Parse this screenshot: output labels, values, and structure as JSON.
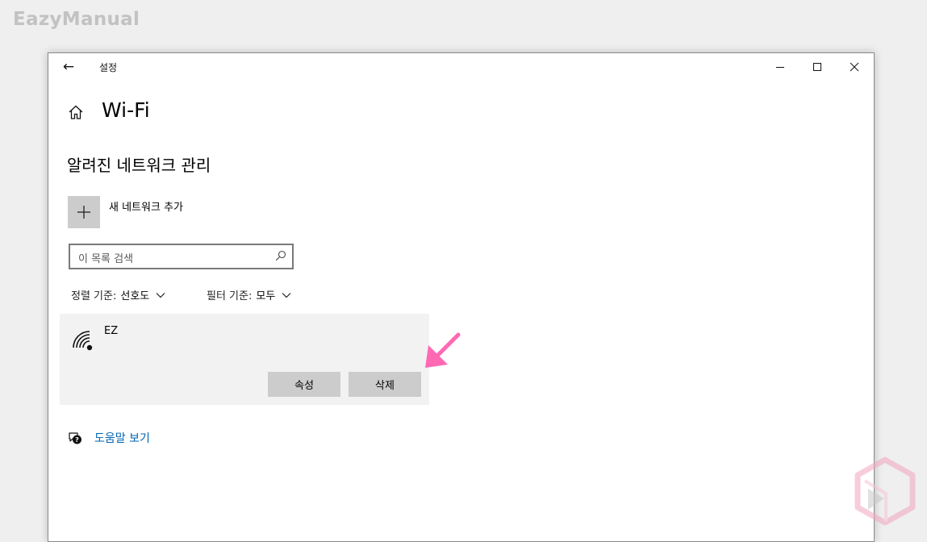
{
  "watermark": {
    "text": "EazyManual"
  },
  "window": {
    "title": "설정",
    "back_icon": "back-arrow-icon",
    "controls": [
      "minimize-icon",
      "maximize-icon",
      "close-icon"
    ]
  },
  "page": {
    "home_icon": "home-icon",
    "title": "Wi-Fi",
    "section_title": "알려진 네트워크 관리"
  },
  "add_network": {
    "icon": "plus-icon",
    "label": "새 네트워크 추가"
  },
  "search": {
    "placeholder": "이 목록 검색",
    "value": "",
    "icon": "search-icon"
  },
  "sort": {
    "label": "정렬 기준:",
    "value": "선호도"
  },
  "filter": {
    "label": "필터 기준:",
    "value": "모두"
  },
  "networks": [
    {
      "name": "EZ",
      "icon": "wifi-secured-icon",
      "properties_label": "속성",
      "forget_label": "삭제"
    }
  ],
  "annotation": {
    "arrow_color": "#ff69b4",
    "points_to": "forget-button"
  },
  "help": {
    "icon": "help-chat-icon",
    "label": "도움말 보기"
  },
  "colors": {
    "background": "#efefef",
    "window": "#ffffff",
    "item_background": "#f2f2f2",
    "button": "#cccccc",
    "link": "#0063b1",
    "arrow": "#ff69b4"
  }
}
